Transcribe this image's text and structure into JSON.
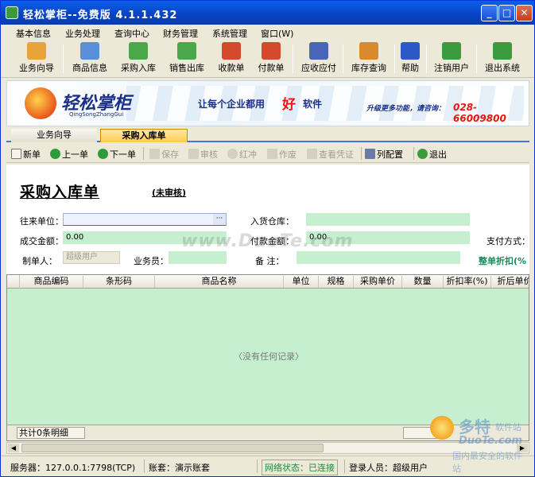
{
  "window": {
    "title": "轻松掌柜--免费版  4.1.1.432"
  },
  "menu": [
    "基本信息",
    "业务处理",
    "查询中心",
    "财务管理",
    "系统管理",
    "窗口(W)"
  ],
  "toolbar": [
    {
      "label": "业务向导",
      "icon": "book-icon",
      "color": "#e8a33a"
    },
    {
      "label": "商品信息",
      "icon": "grid-icon",
      "color": "#5a8fd8"
    },
    {
      "label": "采购入库",
      "icon": "box-in-icon",
      "color": "#4aa84a"
    },
    {
      "label": "销售出库",
      "icon": "box-out-icon",
      "color": "#4aa84a"
    },
    {
      "label": "收款单",
      "icon": "receipt-icon",
      "color": "#d44a2c"
    },
    {
      "label": "付款单",
      "icon": "payment-icon",
      "color": "#d44a2c"
    },
    {
      "label": "应收应付",
      "icon": "chart-icon",
      "color": "#4a64b8"
    },
    {
      "label": "库存查询",
      "icon": "stock-icon",
      "color": "#d88a2c"
    },
    {
      "label": "帮助",
      "icon": "help-icon",
      "color": "#2c58c8"
    },
    {
      "label": "注销用户",
      "icon": "logout-icon",
      "color": "#3c9b3c"
    },
    {
      "label": "退出系统",
      "icon": "exit-icon",
      "color": "#3c9b3c"
    }
  ],
  "banner": {
    "logo": "轻松掌柜",
    "logo_sub": "QingSongZhangGui",
    "slogan_a": "让每个企业都用",
    "slogan_b": "好",
    "slogan_c": "软件",
    "upgrade": "升级更多功能，请咨询：",
    "phone": "028-66009800"
  },
  "tabs": {
    "guide": "业务向导",
    "active": "采购入库单"
  },
  "actions": [
    {
      "label": "新单",
      "enabled": true,
      "icon": "new-doc-icon"
    },
    {
      "label": "上一单",
      "enabled": true,
      "icon": "prev-icon"
    },
    {
      "label": "下一单",
      "enabled": true,
      "icon": "next-icon"
    },
    {
      "label": "保存",
      "enabled": false,
      "icon": "save-icon"
    },
    {
      "label": "审核",
      "enabled": false,
      "icon": "check-icon"
    },
    {
      "label": "红冲",
      "enabled": false,
      "icon": "reverse-icon"
    },
    {
      "label": "作废",
      "enabled": false,
      "icon": "void-icon"
    },
    {
      "label": "查看凭证",
      "enabled": false,
      "icon": "voucher-icon"
    },
    {
      "label": "列配置",
      "enabled": true,
      "icon": "columns-icon"
    },
    {
      "label": "退出",
      "enabled": true,
      "icon": "exit-icon"
    }
  ],
  "form": {
    "title": "采购入库单",
    "status": "(未审核)",
    "partner_label": "往来单位：",
    "partner_value": "",
    "partner_btn": "···",
    "warehouse_label": "入货仓库：",
    "warehouse_value": "",
    "amount_label": "成交金额：",
    "amount_value": "0.00",
    "paid_label": "付款金额：",
    "paid_value": "0.00",
    "paymethod_label": "支付方式：",
    "maker_label": "制单人：",
    "maker_value": "超级用户",
    "clerk_label": "业务员：",
    "clerk_value": "",
    "note_label": "备  注：",
    "note_value": "",
    "discount_label": "整单折扣(%"
  },
  "watermark": "www.DuoTe.com",
  "grid": {
    "columns": [
      "商品编码",
      "条形码",
      "商品名称",
      "单位",
      "规格",
      "采购单价",
      "数量",
      "折扣率(%)",
      "折后单价"
    ],
    "empty_text": "〈没有任何记录〉",
    "footer_count": "共计0条明细"
  },
  "status": {
    "server": "服务器：127.0.0.1:7798(TCP)",
    "account": "账套：演示账套",
    "network": "网络状态：已连接",
    "user": "登录人员：超级用户"
  },
  "site_watermark": {
    "big": "多特",
    "site": "软件站",
    "domain": "DuoTe.com",
    "tag": "国内最安全的软件站"
  }
}
